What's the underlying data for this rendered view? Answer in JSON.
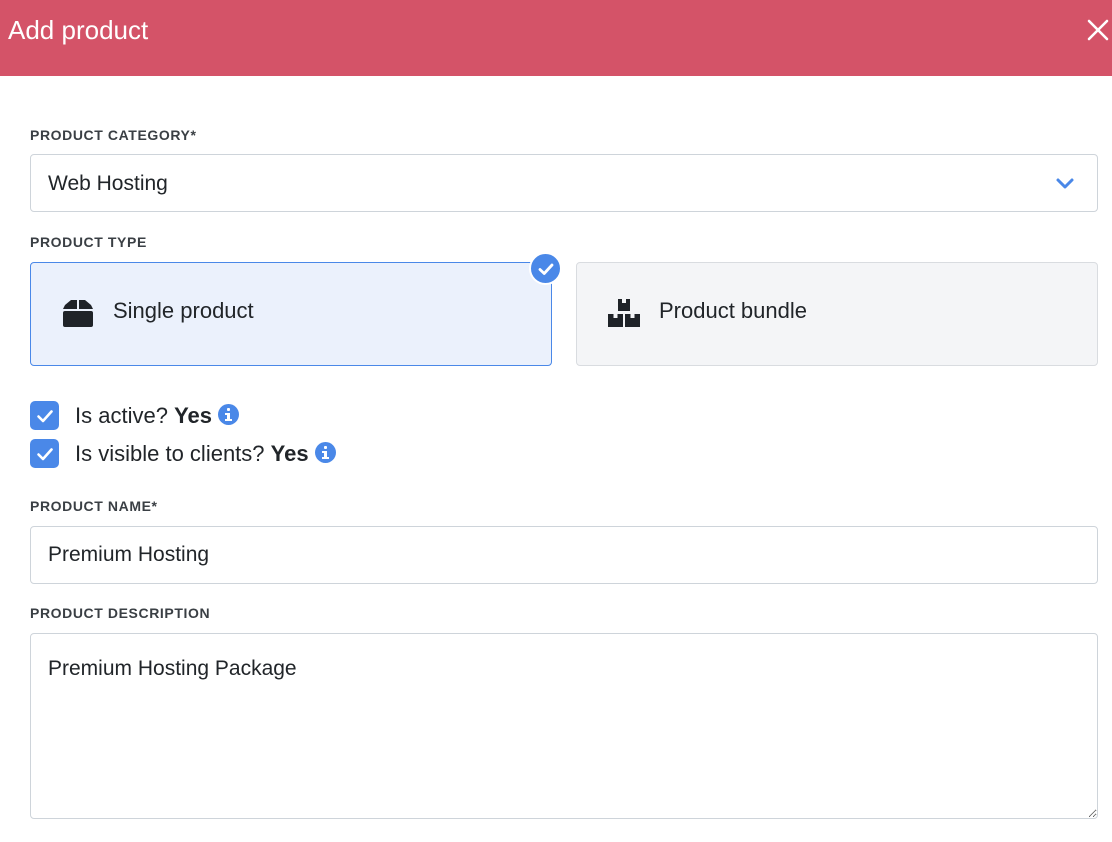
{
  "header": {
    "title": "Add product",
    "close_icon": "close-icon",
    "background": "#d45368"
  },
  "category": {
    "label": "PRODUCT CATEGORY*",
    "value": "Web Hosting",
    "icon": "chevron-down-icon"
  },
  "product_type": {
    "label": "PRODUCT TYPE",
    "options": [
      {
        "label": "Single product",
        "icon": "box-icon",
        "selected": true
      },
      {
        "label": "Product bundle",
        "icon": "boxes-icon",
        "selected": false
      }
    ],
    "selected_badge_icon": "checkmark-circle-icon"
  },
  "flags": [
    {
      "label": "Is active?",
      "value": "Yes",
      "checked": true,
      "info_icon": "info-icon"
    },
    {
      "label": "Is visible to clients?",
      "value": "Yes",
      "checked": true,
      "info_icon": "info-icon"
    }
  ],
  "name": {
    "label": "PRODUCT NAME*",
    "value": "Premium Hosting"
  },
  "description": {
    "label": "PRODUCT DESCRIPTION",
    "value": "Premium Hosting Package"
  },
  "colors": {
    "accent": "#4a88e8",
    "selected_card_bg": "#ebf1fc"
  }
}
